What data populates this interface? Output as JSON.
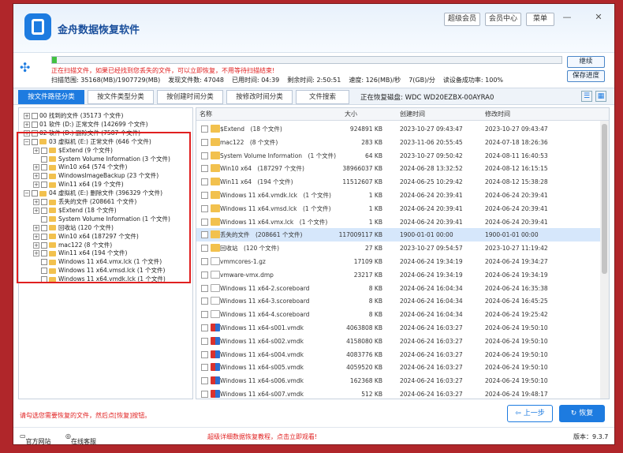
{
  "app": {
    "title": "金舟数据恢复软件",
    "top_buttons": [
      "超级会员",
      "会员中心",
      "菜单"
    ],
    "win_min": "—",
    "win_close": "✕"
  },
  "scan": {
    "progress": 0.01,
    "message": "正在扫描文件，如果已经找到您丢失的文件，可以立即恢复，不用等待扫描结束!",
    "stats": [
      "扫描范围: 35168(MB)/1907729(MB)",
      "发现文件数: 47048",
      "已用时间: 04:39",
      "剩余时间: 2:50:51",
      "速度: 126(MB)/秒",
      "7(GB)/分",
      "读设备成功率: 100%"
    ],
    "continue_label": "继续",
    "save_label": "保存进度"
  },
  "tabs": [
    "按文件路径分类",
    "按文件类型分类",
    "按创建时间分类",
    "按修改时间分类",
    "文件搜索"
  ],
  "disk_label": "正在恢复磁盘: WDC WD20EZBX-00AYRA0",
  "tree": [
    {
      "t": "00 找到的文件 (35173 个文件)",
      "lvl": 0,
      "exp": "+",
      "folder": false
    },
    {
      "t": "01 软件 (D:) 正常文件 (142699 个文件)",
      "lvl": 0,
      "exp": "+",
      "folder": false
    },
    {
      "t": "02 软件 (D:) 删除文件 (7587 个文件)",
      "lvl": 0,
      "exp": "+",
      "folder": false
    },
    {
      "t": "03 虚拟机 (E:) 正常文件 (646 个文件)",
      "lvl": 0,
      "exp": "−",
      "folder": true
    },
    {
      "t": "$Extend (9 个文件)",
      "lvl": 1,
      "exp": "+",
      "folder": true
    },
    {
      "t": "System Volume Information (3 个文件)",
      "lvl": 1,
      "exp": "",
      "folder": true
    },
    {
      "t": "Win10 x64 (574 个文件)",
      "lvl": 1,
      "exp": "+",
      "folder": true
    },
    {
      "t": "WindowsImageBackup (23 个文件)",
      "lvl": 1,
      "exp": "+",
      "folder": true
    },
    {
      "t": "Win11 x64 (19 个文件)",
      "lvl": 1,
      "exp": "+",
      "folder": true
    },
    {
      "t": "04 虚拟机 (E:) 删除文件 (396329 个文件)",
      "lvl": 0,
      "exp": "−",
      "folder": true
    },
    {
      "t": "丢失的文件 (208661 个文件)",
      "lvl": 1,
      "exp": "+",
      "folder": true
    },
    {
      "t": "$Extend (18 个文件)",
      "lvl": 1,
      "exp": "+",
      "folder": true
    },
    {
      "t": "System Volume Information (1 个文件)",
      "lvl": 1,
      "exp": "",
      "folder": true
    },
    {
      "t": "回收站 (120 个文件)",
      "lvl": 1,
      "exp": "+",
      "folder": true
    },
    {
      "t": "Win10 x64 (187297 个文件)",
      "lvl": 1,
      "exp": "+",
      "folder": true
    },
    {
      "t": "mac122 (8 个文件)",
      "lvl": 1,
      "exp": "+",
      "folder": true
    },
    {
      "t": "Win11 x64 (194 个文件)",
      "lvl": 1,
      "exp": "+",
      "folder": true
    },
    {
      "t": "Windows 11 x64.vmx.lck (1 个文件)",
      "lvl": 1,
      "exp": "",
      "folder": true
    },
    {
      "t": "Windows 11 x64.vmsd.lck (1 个文件)",
      "lvl": 1,
      "exp": "",
      "folder": true
    },
    {
      "t": "Windows 11 x64.vmdk.lck (1 个文件)",
      "lvl": 1,
      "exp": "",
      "folder": true
    }
  ],
  "columns": [
    "名称",
    "大小",
    "创建时间",
    "修改时间"
  ],
  "rows": [
    {
      "n": "$Extend　(18 个文件)",
      "s": "924891 KB",
      "c": "2023-10-27 09:43:47",
      "m": "2023-10-27 09:43:47",
      "i": "folder"
    },
    {
      "n": "mac122　(8 个文件)",
      "s": "283 KB",
      "c": "2023-11-06 20:55:45",
      "m": "2024-07-18 18:26:36",
      "i": "folder"
    },
    {
      "n": "System Volume Information　(1 个文件)",
      "s": "64 KB",
      "c": "2023-10-27 09:50:42",
      "m": "2024-08-11 16:40:53",
      "i": "folder"
    },
    {
      "n": "Win10 x64　(187297 个文件)",
      "s": "38966037 KB",
      "c": "2024-06-28 13:32:52",
      "m": "2024-08-12 16:15:15",
      "i": "folder"
    },
    {
      "n": "Win11 x64　(194 个文件)",
      "s": "11512607 KB",
      "c": "2024-06-25 10:29:42",
      "m": "2024-08-12 15:38:28",
      "i": "folder"
    },
    {
      "n": "Windows 11 x64.vmdk.lck　(1 个文件)",
      "s": "1 KB",
      "c": "2024-06-24 20:39:41",
      "m": "2024-06-24 20:39:41",
      "i": "folder"
    },
    {
      "n": "Windows 11 x64.vmsd.lck　(1 个文件)",
      "s": "1 KB",
      "c": "2024-06-24 20:39:41",
      "m": "2024-06-24 20:39:41",
      "i": "folder"
    },
    {
      "n": "Windows 11 x64.vmx.lck　(1 个文件)",
      "s": "1 KB",
      "c": "2024-06-24 20:39:41",
      "m": "2024-06-24 20:39:41",
      "i": "folder"
    },
    {
      "n": "丢失的文件　(208661 个文件)",
      "s": "117009117 KB",
      "c": "1900-01-01 00:00",
      "m": "1900-01-01 00:00",
      "i": "folder",
      "sel": true
    },
    {
      "n": "回收站　(120 个文件)",
      "s": "27 KB",
      "c": "2023-10-27 09:54:57",
      "m": "2023-10-27 11:19:42",
      "i": "folder"
    },
    {
      "n": "vmmcores-1.gz",
      "s": "17109 KB",
      "c": "2024-06-24 19:34:19",
      "m": "2024-06-24 19:34:27",
      "i": "file"
    },
    {
      "n": "vmware-vmx.dmp",
      "s": "23217 KB",
      "c": "2024-06-24 19:34:19",
      "m": "2024-06-24 19:34:19",
      "i": "file"
    },
    {
      "n": "Windows 11 x64-2.scoreboard",
      "s": "8 KB",
      "c": "2024-06-24 16:04:34",
      "m": "2024-06-24 16:35:38",
      "i": "file"
    },
    {
      "n": "Windows 11 x64-3.scoreboard",
      "s": "8 KB",
      "c": "2024-06-24 16:04:34",
      "m": "2024-06-24 16:45:25",
      "i": "file"
    },
    {
      "n": "Windows 11 x64-4.scoreboard",
      "s": "8 KB",
      "c": "2024-06-24 16:04:34",
      "m": "2024-06-24 19:25:42",
      "i": "file"
    },
    {
      "n": "Windows 11 x64-s001.vmdk",
      "s": "4063808 KB",
      "c": "2024-06-24 16:03:27",
      "m": "2024-06-24 19:50:10",
      "i": "vm"
    },
    {
      "n": "Windows 11 x64-s002.vmdk",
      "s": "4158080 KB",
      "c": "2024-06-24 16:03:27",
      "m": "2024-06-24 19:50:10",
      "i": "vm"
    },
    {
      "n": "Windows 11 x64-s004.vmdk",
      "s": "4083776 KB",
      "c": "2024-06-24 16:03:27",
      "m": "2024-06-24 19:50:10",
      "i": "vm"
    },
    {
      "n": "Windows 11 x64-s005.vmdk",
      "s": "4059520 KB",
      "c": "2024-06-24 16:03:27",
      "m": "2024-06-24 19:50:10",
      "i": "vm"
    },
    {
      "n": "Windows 11 x64-s006.vmdk",
      "s": "162368 KB",
      "c": "2024-06-24 16:03:27",
      "m": "2024-06-24 19:50:10",
      "i": "vm"
    },
    {
      "n": "Windows 11 x64-s007.vmdk",
      "s": "512 KB",
      "c": "2024-06-24 16:03:27",
      "m": "2024-06-24 19:48:17",
      "i": "vm"
    }
  ],
  "hint": "请勾选您需要恢复的文件，然后点[恢复]按钮。",
  "prev_label": "上一步",
  "recover_label": "恢复",
  "footer": {
    "site": "官方网站",
    "service": "在线客服",
    "tutorial": "超级详细数据恢复教程，点击立即观看!",
    "version": "版本：9.3.7"
  }
}
